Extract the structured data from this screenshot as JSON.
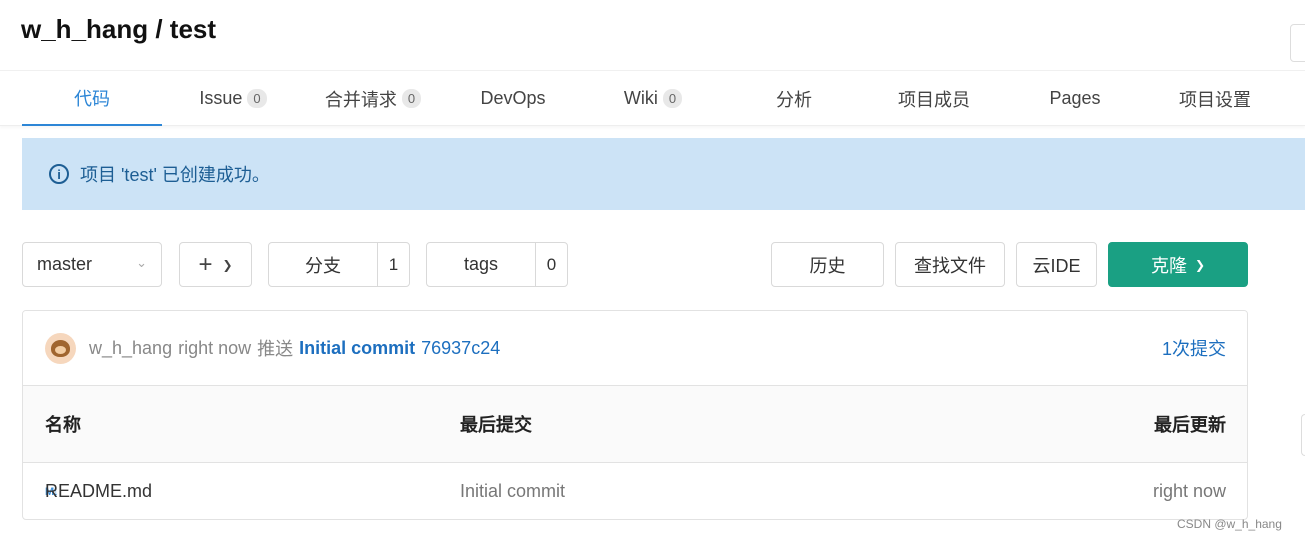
{
  "header": {
    "title": "w_h_hang / test"
  },
  "tabs": [
    {
      "label": "代码",
      "badge": null
    },
    {
      "label": "Issue",
      "badge": "0"
    },
    {
      "label": "合并请求",
      "badge": "0"
    },
    {
      "label": "DevOps",
      "badge": null
    },
    {
      "label": "Wiki",
      "badge": "0"
    },
    {
      "label": "分析",
      "badge": null
    },
    {
      "label": "项目成员",
      "badge": null
    },
    {
      "label": "Pages",
      "badge": null
    },
    {
      "label": "项目设置",
      "badge": null
    }
  ],
  "alert": {
    "icon": "info-icon",
    "message": "项目 'test' 已创建成功。"
  },
  "toolbar": {
    "branch": "master",
    "branches_label": "分支",
    "branches_count": "1",
    "tags_label": "tags",
    "tags_count": "0",
    "history_label": "历史",
    "find_file_label": "查找文件",
    "cloud_ide_label": "云IDE",
    "clone_label": "克隆"
  },
  "commit": {
    "author": "w_h_hang",
    "time": "right now",
    "action": "推送",
    "message": "Initial commit",
    "sha": "76937c24",
    "count_label": "1次提交"
  },
  "table": {
    "headers": {
      "name": "名称",
      "last_commit": "最后提交",
      "last_update": "最后更新"
    },
    "rows": [
      {
        "icon": "markdown-icon",
        "icon_text": "M↓",
        "name": "README.md",
        "last_commit": "Initial commit",
        "last_update": "right now"
      }
    ]
  },
  "watermark": "CSDN @w_h_hang",
  "colors": {
    "accent": "#2d86d6",
    "clone_button": "#1aa083",
    "alert_bg": "#cce3f6",
    "link": "#1d6fbf"
  }
}
